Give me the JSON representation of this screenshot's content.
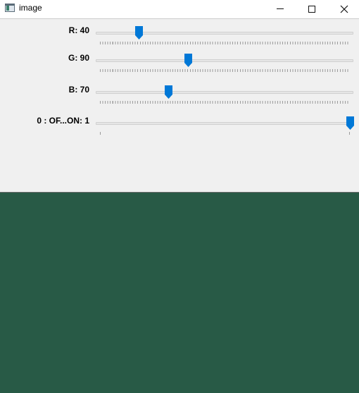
{
  "window": {
    "title": "image",
    "icon": "app-window-icon",
    "controls": [
      "minimize-icon",
      "maximize-icon",
      "close-icon"
    ]
  },
  "trackbars": [
    {
      "label": "R: 40",
      "value": 40,
      "max": 255
    },
    {
      "label": "G: 90",
      "value": 90,
      "max": 255
    },
    {
      "label": "B: 70",
      "value": 70,
      "max": 255
    },
    {
      "label": "0 : OF...ON: 1",
      "value": 1,
      "max": 1
    }
  ],
  "image": {
    "color": "#285a46"
  },
  "colors": {
    "thumb": "#0078d7",
    "panel": "#f0f0f0"
  }
}
